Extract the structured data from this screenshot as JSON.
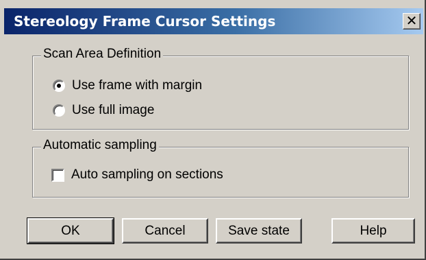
{
  "window": {
    "title": "Stereology Frame Cursor Settings",
    "close_glyph": "✕"
  },
  "scan_area": {
    "label": "Scan Area Definition",
    "options": [
      {
        "label": "Use frame with margin",
        "selected": true
      },
      {
        "label": "Use full image",
        "selected": false
      }
    ]
  },
  "automatic_sampling": {
    "label": "Automatic sampling",
    "checkbox_label": "Auto sampling on sections",
    "checked": false
  },
  "buttons": {
    "ok": "OK",
    "cancel": "Cancel",
    "save_state": "Save state",
    "help": "Help"
  }
}
